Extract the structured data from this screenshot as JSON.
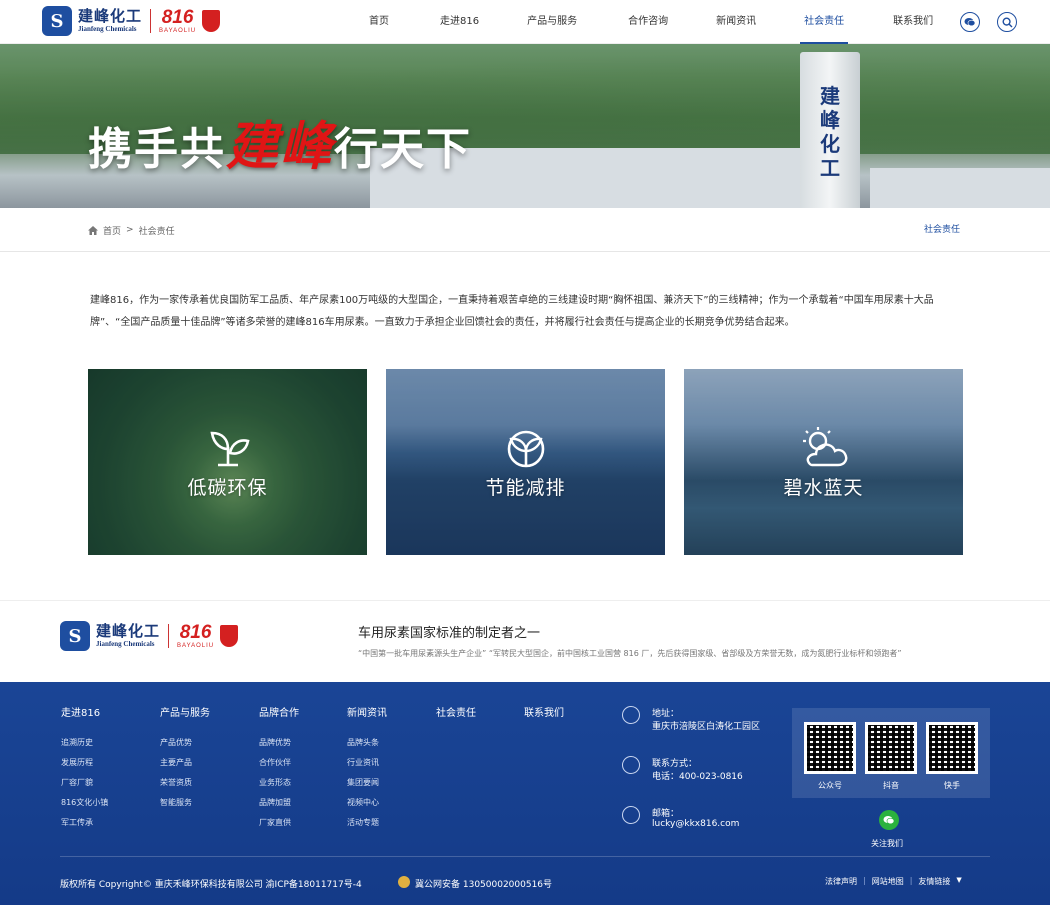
{
  "header": {
    "logo": {
      "cn": "建峰化工",
      "en": "Jianfeng Chemicals",
      "brand_num": "816",
      "brand_sub": "BAYAOLIU"
    },
    "nav": [
      "首页",
      "走进816",
      "产品与服务",
      "合作咨询",
      "新闻资讯",
      "社会责任",
      "联系我们"
    ],
    "active_nav": "社会责任",
    "icons": [
      "wechat-icon",
      "search-icon"
    ]
  },
  "banner": {
    "slogan_a": "携手共",
    "slogan_red": "建峰",
    "slogan_b": "行天下",
    "tower_text": "建峰化工"
  },
  "breadcrumb": {
    "home": "首页",
    "sep": ">",
    "current": "社会责任",
    "right": "社会责任"
  },
  "intro": "建峰816，作为一家传承着优良国防军工品质、年产尿素100万吨级的大型国企，一直秉持着艰苦卓绝的三线建设时期“胸怀祖国、兼济天下”的三线精神；作为一个承载着“中国车用尿素十大品牌”、“全国产品质量十佳品牌”等诸多荣誉的建峰816车用尿素。一直致力于承担企业回馈社会的责任，并将履行社会责任与提高企业的长期竞争优势结合起来。",
  "cards": [
    {
      "title": "低碳环保",
      "icon": "sprout-icon"
    },
    {
      "title": "节能减排",
      "icon": "leaf-circle-icon"
    },
    {
      "title": "碧水蓝天",
      "icon": "sun-cloud-icon"
    }
  ],
  "mid_footer": {
    "title": "车用尿素国家标准的制定者之一",
    "subtitle": "“中国第一批车用尿素源头生产企业”  “军转民大型国企，前中国核工业国营 816 厂，先后获得国家级、省部级及方荣誉无数，成为氮肥行业标杆和领跑者”"
  },
  "footer": {
    "columns": [
      {
        "head": "走进816",
        "links": [
          "追溯历史",
          "发展历程",
          "厂容厂貌",
          "816文化小镇",
          "军工传承"
        ]
      },
      {
        "head": "产品与服务",
        "links": [
          "产品优势",
          "主要产品",
          "荣誉资质",
          "智能服务"
        ]
      },
      {
        "head": "品牌合作",
        "links": [
          "品牌优势",
          "合作伙伴",
          "业务形态",
          "品牌加盟",
          "厂家直供"
        ]
      },
      {
        "head": "新闻资讯",
        "links": [
          "品牌头条",
          "行业资讯",
          "集团要闻",
          "视频中心",
          "活动专题"
        ]
      },
      {
        "head": "社会责任",
        "links": []
      },
      {
        "head": "联系我们",
        "links": []
      }
    ],
    "contact": [
      {
        "label": "地址：",
        "value": "重庆市涪陵区白涛化工园区",
        "icon": "location-icon"
      },
      {
        "label": "联系方式：",
        "value": "电话：400-023-0816",
        "icon": "phone-icon"
      },
      {
        "label": "邮箱：",
        "value": "lucky@kkx816.com",
        "icon": "email-icon"
      }
    ],
    "qr_codes": [
      "公众号",
      "抖音",
      "快手"
    ],
    "wechat_label": "关注我们",
    "copyright": "版权所有 Copyright© 重庆禾峰环保科技有限公司   渝ICP备18011717号-4",
    "police": "冀公网安备 13050002000516号",
    "bottom_links": [
      "法律声明",
      "网站地图",
      "友情链接"
    ],
    "accent": "#1a4596"
  }
}
